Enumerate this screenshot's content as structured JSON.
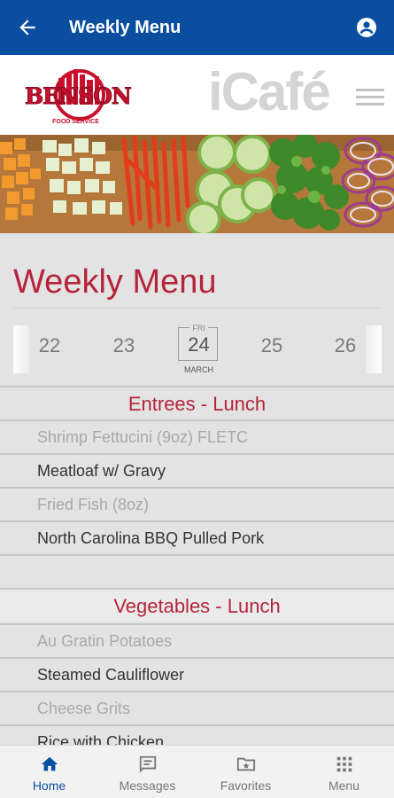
{
  "header": {
    "title": "Weekly Menu",
    "back_icon": "arrow-left-icon",
    "account_icon": "account-circle-icon",
    "bar_color": "#0a4ea0"
  },
  "brand": {
    "logo_text": "BENSON",
    "logo_subtext": "FOOD SERVICE",
    "app_name": "iCafé",
    "menu_icon": "hamburger-icon"
  },
  "page": {
    "title": "Weekly Menu",
    "accent_color": "#b5243a"
  },
  "dates": {
    "items": [
      "22",
      "23",
      "24",
      "25",
      "26"
    ],
    "selected": {
      "day_of_week": "FRI",
      "day": "24",
      "month": "MARCH"
    }
  },
  "menu": {
    "sections": [
      {
        "heading": "Entrees - Lunch",
        "items": [
          "Shrimp Fettucini (9oz) FLETC",
          "Meatloaf w/ Gravy",
          "Fried Fish (8oz)",
          "North Carolina BBQ Pulled Pork"
        ]
      },
      {
        "heading": "Vegetables - Lunch",
        "items": [
          "Au Gratin Potatoes",
          "Steamed Cauliflower",
          "Cheese Grits",
          "Rice with Chicken"
        ]
      }
    ]
  },
  "nav": {
    "items": [
      {
        "label": "Home",
        "icon": "home-icon",
        "active": true
      },
      {
        "label": "Messages",
        "icon": "message-icon",
        "active": false
      },
      {
        "label": "Favorites",
        "icon": "folder-star-icon",
        "active": false
      },
      {
        "label": "Menu",
        "icon": "grid-icon",
        "active": false
      }
    ]
  }
}
